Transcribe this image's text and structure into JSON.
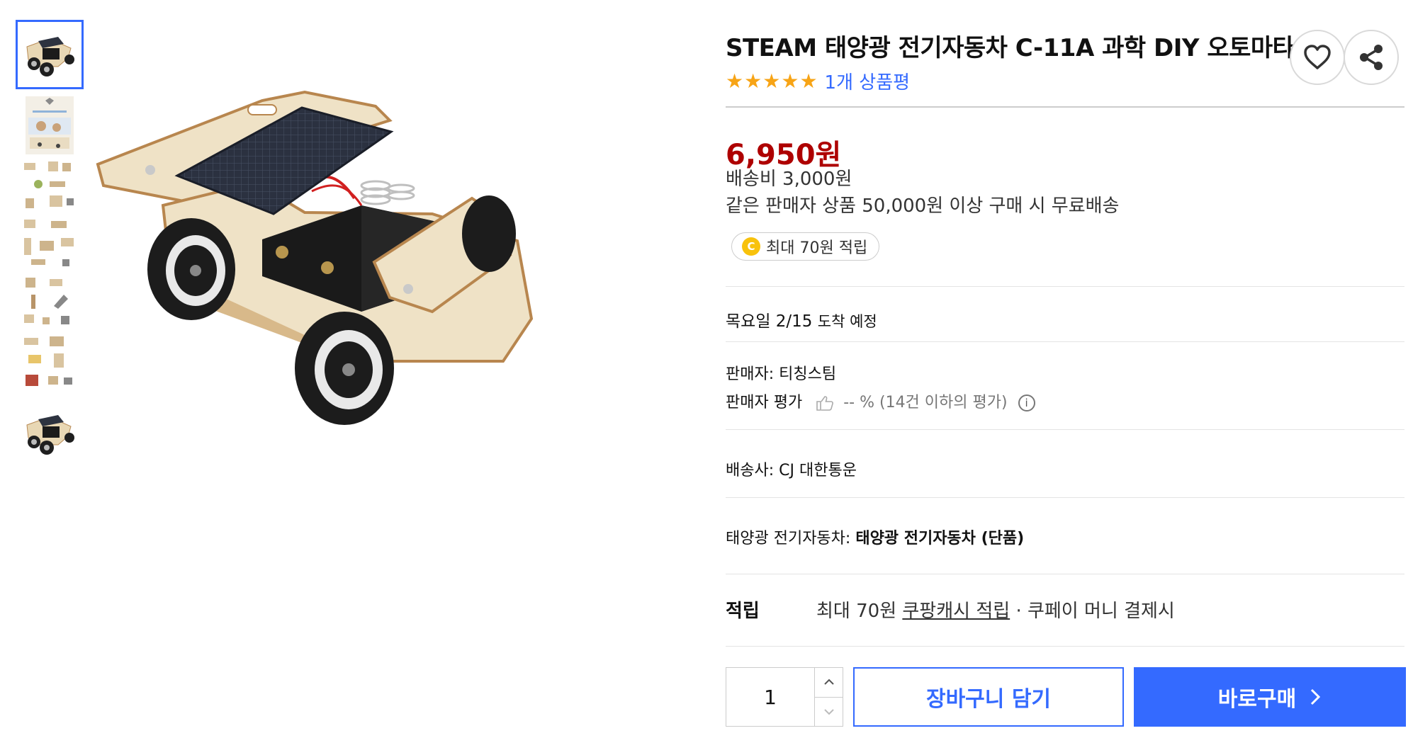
{
  "product": {
    "title": "STEAM 태양광 전기자동차 C-11A 과학 DIY 오토마타",
    "rating_stars": 5,
    "review_count_label": "1개 상품평"
  },
  "actions": {
    "wishlist_icon": "heart-icon",
    "share_icon": "share-icon"
  },
  "price": {
    "amount": "6,950원",
    "shipping_fee": "배송비 3,000원",
    "free_shipping_note": "같은 판매자 상품 50,000원 이상 구매 시 무료배송",
    "reward_badge": {
      "coin": "C",
      "label": "최대 70원 적립"
    }
  },
  "delivery": {
    "date": "목요일 2/15",
    "label": "도착 예정"
  },
  "seller": {
    "name_label": "판매자: 티칭스팀",
    "rating_label": "판매자 평가",
    "rating_value": "-- %",
    "rating_note": "(14건 이하의 평가)"
  },
  "carrier": {
    "label": "배송사: CJ 대한통운"
  },
  "option": {
    "label": "태양광 전기자동차:",
    "value": "태양광 전기자동차 (단품)"
  },
  "reward": {
    "label": "적립",
    "prefix": "최대 70원",
    "link": "쿠팡캐시 적립",
    "suffix": "· 쿠페이 머니 결제시"
  },
  "purchase": {
    "quantity": "1",
    "add_to_cart": "장바구니 담기",
    "buy_now": "바로구매"
  },
  "colors": {
    "accent_blue": "#346aff",
    "price_red": "#ae0000",
    "star_orange": "#f7a416",
    "coin_yellow": "#f8c20c"
  },
  "thumbnails": [
    {
      "name": "solar-car-thumbnail",
      "selected": true
    },
    {
      "name": "kit-package-thumbnail",
      "selected": false
    },
    {
      "name": "kit-collection-thumbnail-1",
      "selected": false
    },
    {
      "name": "kit-collection-thumbnail-2",
      "selected": false
    },
    {
      "name": "kit-collection-thumbnail-3",
      "selected": false
    },
    {
      "name": "kit-collection-thumbnail-4",
      "selected": false
    },
    {
      "name": "solar-car-thumbnail-2",
      "selected": false
    }
  ]
}
